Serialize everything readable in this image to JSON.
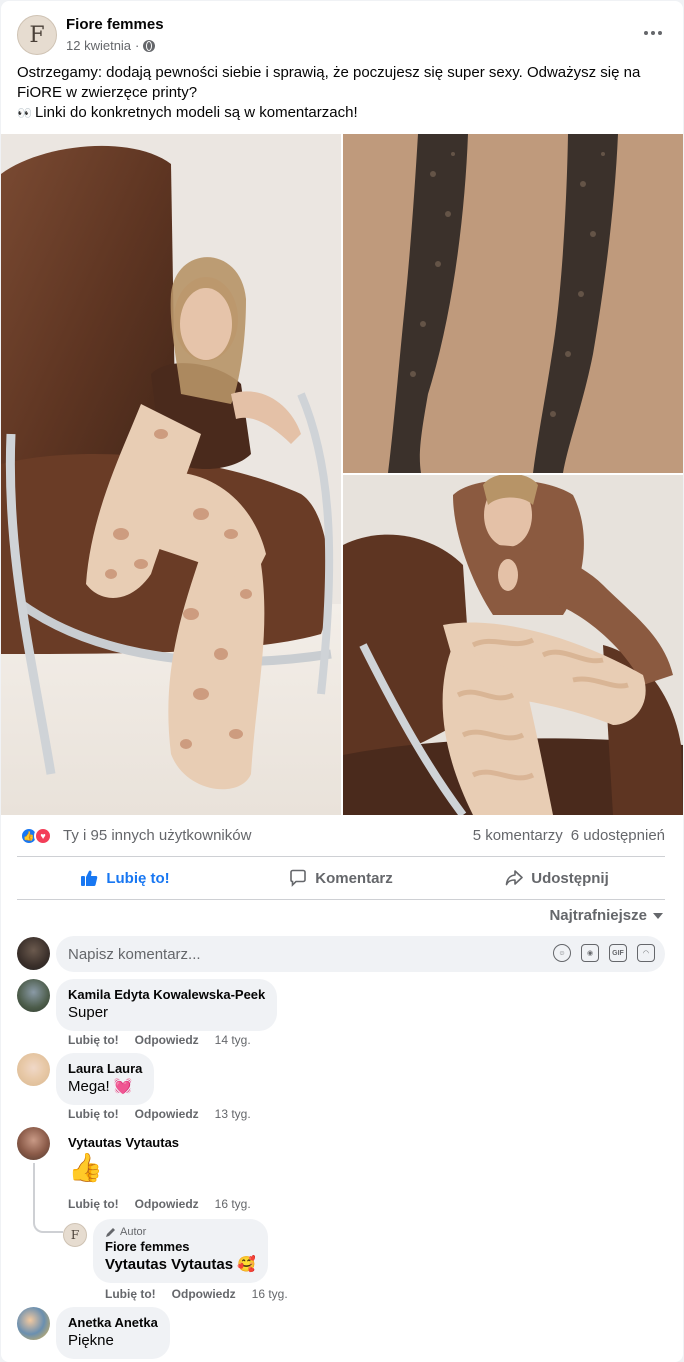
{
  "post": {
    "page_name": "Fiore femmes",
    "page_initial": "F",
    "date": "12 kwietnia",
    "separator": "·",
    "text_line1": "Ostrzegamy: dodają pewności siebie i sprawią, że poczujesz się super sexy. Odważysz się na FiORE w zwierzęce printy?",
    "text_emoji": "👀",
    "text_line2": "Linki do konkretnych modeli są w komentarzach!"
  },
  "reactions": {
    "summary": "Ty i 95 innych użytkowników",
    "comments": "5 komentarzy",
    "shares": "6 udostępnień"
  },
  "actions": {
    "like": "Lubię to!",
    "comment": "Komentarz",
    "share": "Udostępnij"
  },
  "sort": {
    "label": "Najtrafniejsze"
  },
  "composer": {
    "placeholder": "Napisz komentarz..."
  },
  "comments": [
    {
      "author": "Kamila Edyta Kowalewska-Peek",
      "text": "Super",
      "like": "Lubię to!",
      "reply": "Odpowiedz",
      "time": "14 tyg."
    },
    {
      "author": "Laura Laura",
      "text": "Mega! 💓",
      "like": "Lubię to!",
      "reply": "Odpowiedz",
      "time": "13 tyg."
    },
    {
      "author": "Vytautas Vytautas",
      "text": "👍",
      "like": "Lubię to!",
      "reply": "Odpowiedz",
      "time": "16 tyg."
    },
    {
      "badge": "Autor",
      "author": "Fiore femmes",
      "initial": "F",
      "text": "Vytautas Vytautas 🥰",
      "like": "Lubię to!",
      "reply": "Odpowiedz",
      "time": "16 tyg."
    },
    {
      "author": "Anetka Anetka",
      "text": "Piękne"
    }
  ],
  "colors": {
    "accent": "#1877f2",
    "love": "#f33e58",
    "muted": "#65676b"
  }
}
